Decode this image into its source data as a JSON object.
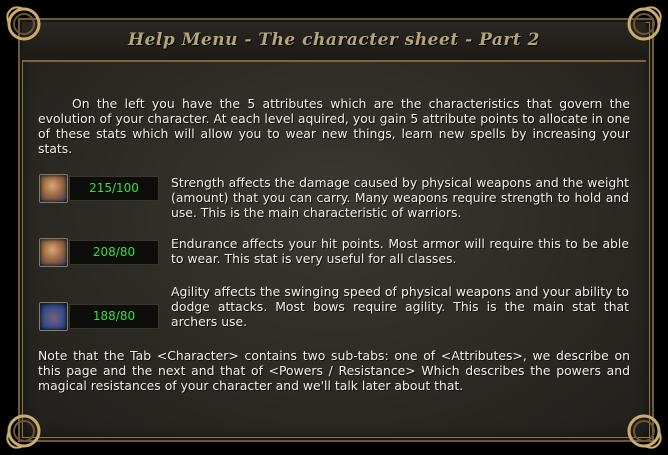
{
  "window": {
    "title": "Help Menu - The character sheet - Part 2"
  },
  "intro": "On the left you have the 5 attributes which are the characteristics that govern the evolution of your character. At each level aquired, you gain 5 attribute points to allocate in one of these stats which will allow you to wear new things, learn new spells by increasing your stats.",
  "stats": [
    {
      "icon": "strength-icon",
      "value": "215/100",
      "description": "Strength affects the damage caused by physical weapons and the weight (amount) that you can carry. Many weapons require strength to hold and use. This is the main characteristic of warriors."
    },
    {
      "icon": "endurance-icon",
      "value": "208/80",
      "description": "Endurance affects your hit points. Most armor will require this to be able to wear. This stat is very useful for all classes."
    },
    {
      "icon": "agility-icon",
      "value": "188/80",
      "description": "Agility affects the swinging speed of physical weapons and your ability to dodge attacks. Most bows require agility. This is the main stat that archers use."
    }
  ],
  "outro": "Note that the Tab <Character> contains two sub-tabs: one of <Attributes>, we describe on this page and the next and that of <Powers / Resistance> Which describes the powers and magical resistances of your character and we'll talk later about that.",
  "colors": {
    "title": "#b3a47a",
    "stat_value": "#3ddc3d",
    "frame_gold": "#8a7448"
  }
}
